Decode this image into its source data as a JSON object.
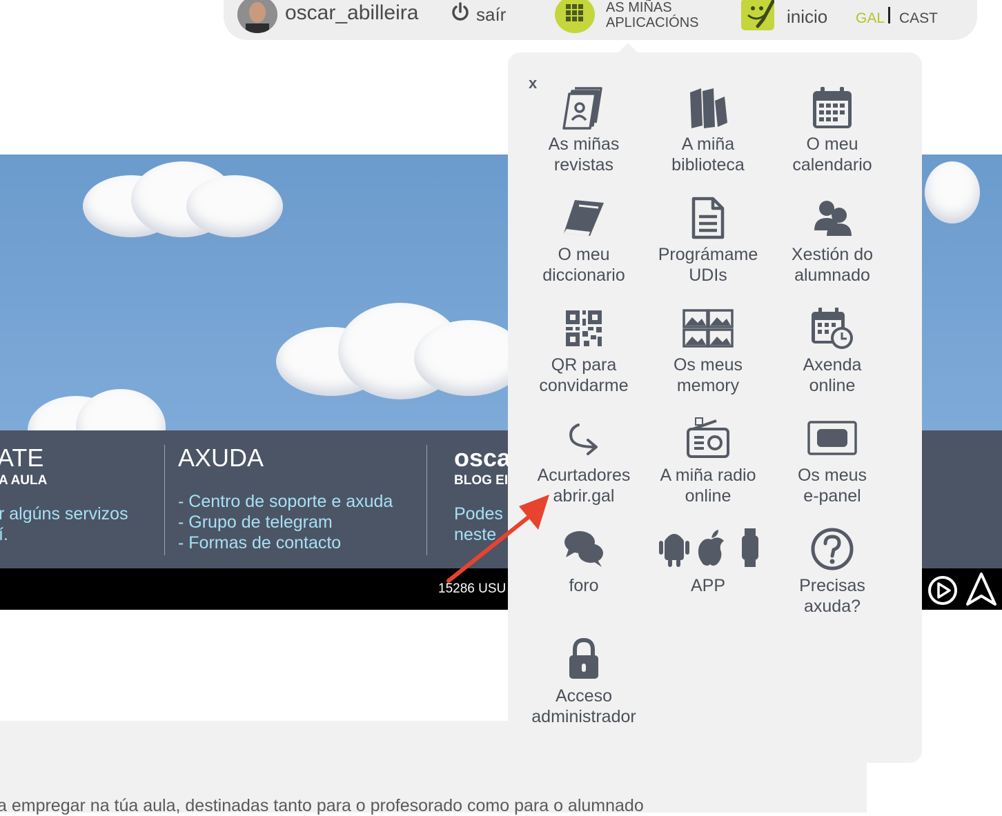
{
  "topbar": {
    "username": "oscar_abilleira",
    "logout_label": "saír",
    "apps_label": "AS MIÑAS APLICACIÓNS",
    "home_label": "inicio",
    "lang_gal": "GAL",
    "lang_cast": "CAST",
    "accent_color": "#c4d63c"
  },
  "footer_panel": {
    "col1": {
      "title": "ATE",
      "subtitle": "A AULA",
      "line1": "r algúns servizos",
      "line2": "í."
    },
    "col2": {
      "title": "AXUDA",
      "links": [
        "- Centro de soporte e axuda",
        "- Grupo de telegram",
        "- Formas de contacto"
      ]
    },
    "col3": {
      "title": "osca",
      "subtitle": "BLOG EI",
      "line1": "Podes",
      "line2": "neste"
    },
    "user_count": "15286 USU"
  },
  "bottom_text": "a empregar na túa aula, destinadas tanto para o profesorado como para o alumnado",
  "popup": {
    "close_label": "x",
    "apps": [
      {
        "line1": "As miñas",
        "line2": "revistas",
        "icon": "magazines-icon"
      },
      {
        "line1": "A miña",
        "line2": "biblioteca",
        "icon": "books-icon"
      },
      {
        "line1": "O meu",
        "line2": "calendario",
        "icon": "calendar-icon"
      },
      {
        "line1": "O meu",
        "line2": "diccionario",
        "icon": "dictionary-icon"
      },
      {
        "line1": "Prográmame",
        "line2": "UDIs",
        "icon": "document-icon"
      },
      {
        "line1": "Xestión do",
        "line2": "alumnado",
        "icon": "students-icon"
      },
      {
        "line1": "QR para",
        "line2": "convidarme",
        "icon": "qr-icon"
      },
      {
        "line1": "Os meus",
        "line2": "memory",
        "icon": "memory-icon"
      },
      {
        "line1": "Axenda",
        "line2": "online",
        "icon": "agenda-icon"
      },
      {
        "line1": "Acurtadores",
        "line2": "abrir.gal",
        "icon": "share-arrow-icon"
      },
      {
        "line1": "A miña radio",
        "line2": "online",
        "icon": "radio-icon"
      },
      {
        "line1": "Os meus",
        "line2": "e-panel",
        "icon": "panel-icon"
      },
      {
        "line1": "foro",
        "line2": "",
        "icon": "forum-icon"
      },
      {
        "line1": "APP",
        "line2": "",
        "icon": "app-platforms-icon"
      },
      {
        "line1": "Precisas",
        "line2": "axuda?",
        "icon": "help-icon"
      },
      {
        "line1": "Acceso",
        "line2": "administrador",
        "icon": "lock-icon"
      }
    ]
  },
  "annotation_arrow_color": "#e8432e"
}
